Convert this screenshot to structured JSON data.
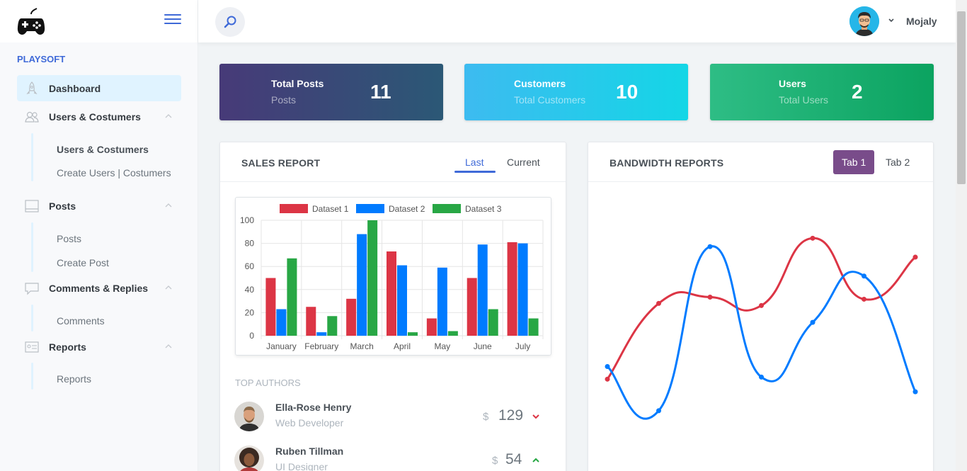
{
  "sidebar": {
    "heading": "PLAYSOFT",
    "items": [
      {
        "label": "Dashboard",
        "icon": "rocket-icon"
      },
      {
        "label": "Users & Costumers",
        "icon": "users-icon",
        "children": [
          "Users & Costumers",
          "Create Users | Costumers"
        ]
      },
      {
        "label": "Posts",
        "icon": "browser-icon",
        "children": [
          "Posts",
          "Create Post"
        ]
      },
      {
        "label": "Comments & Replies",
        "icon": "comment-icon",
        "children": [
          "Comments"
        ]
      },
      {
        "label": "Reports",
        "icon": "id-card-icon",
        "children": [
          "Reports"
        ]
      }
    ]
  },
  "topbar": {
    "user_name": "Mojaly"
  },
  "stats": [
    {
      "title": "Total Posts",
      "subtitle": "Posts",
      "value": "11"
    },
    {
      "title": "Customers",
      "subtitle": "Total Customers",
      "value": "10"
    },
    {
      "title": "Users",
      "subtitle": "Total Users",
      "value": "2"
    }
  ],
  "sales": {
    "title": "SALES REPORT",
    "tabs": [
      "Last",
      "Current"
    ],
    "top_authors_heading": "TOP AUTHORS",
    "authors": [
      {
        "name": "Ella-Rose Henry",
        "role": "Web Developer",
        "currency": "$",
        "value": "129",
        "trend": "down"
      },
      {
        "name": "Ruben Tillman",
        "role": "UI Designer",
        "currency": "$",
        "value": "54",
        "trend": "up"
      }
    ]
  },
  "bandwidth": {
    "title": "BANDWIDTH REPORTS",
    "tabs": [
      "Tab 1",
      "Tab 2"
    ]
  },
  "colors": {
    "accent": "#3f6ad8",
    "red": "#dc3545",
    "blue": "#007bff",
    "green": "#28a745",
    "purple": "#794c8a"
  },
  "chart_data": [
    {
      "type": "bar",
      "categories": [
        "January",
        "February",
        "March",
        "April",
        "May",
        "June",
        "July"
      ],
      "series": [
        {
          "name": "Dataset 1",
          "color": "#dc3545",
          "values": [
            50,
            25,
            32,
            73,
            15,
            50,
            81
          ]
        },
        {
          "name": "Dataset 2",
          "color": "#007bff",
          "values": [
            23,
            3,
            88,
            61,
            59,
            79,
            80
          ]
        },
        {
          "name": "Dataset 3",
          "color": "#28a745",
          "values": [
            67,
            17,
            100,
            3,
            4,
            23,
            15
          ]
        }
      ],
      "yticks": [
        "0",
        "20",
        "40",
        "60",
        "80",
        "100"
      ],
      "ylim": [
        0,
        100
      ],
      "grid": true,
      "legend": "top"
    },
    {
      "type": "line",
      "series": [
        {
          "color": "#dc3545",
          "values": [
            45,
            81,
            84,
            80,
            112,
            83,
            103
          ]
        },
        {
          "color": "#007bff",
          "values": [
            51,
            30,
            108,
            46,
            72,
            94,
            39
          ]
        }
      ],
      "ylim": [
        0,
        135
      ],
      "grid": false
    }
  ]
}
